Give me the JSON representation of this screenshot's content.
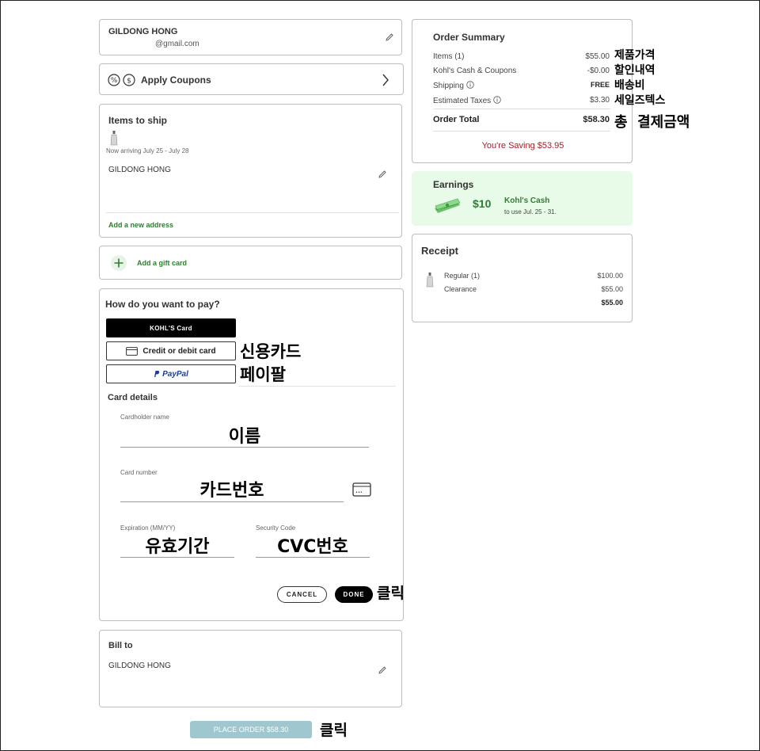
{
  "account": {
    "name": "GILDONG HONG",
    "email": "@gmail.com"
  },
  "coupons": {
    "label": "Apply Coupons"
  },
  "items_to_ship": {
    "title": "Items to ship",
    "arrival": "Now arriving July 25 - July 28",
    "address_name": "GILDONG HONG",
    "add_address": "Add a new address"
  },
  "gift_card": {
    "label": "Add a gift card"
  },
  "payment": {
    "title": "How do you want to pay?",
    "kohls_card": "KOHL'S Card",
    "credit_debit": "Credit or debit card",
    "paypal": "PayPal",
    "card_details_title": "Card details",
    "cardholder_label": "Cardholder name",
    "cardholder_value": "이름",
    "card_number_label": "Card number",
    "card_number_value": "카드번호",
    "expiration_label": "Expiration (MM/YY)",
    "expiration_value": "유효기간",
    "security_label": "Security Code",
    "security_value": "CVC번호",
    "cancel_label": "CANCEL",
    "done_label": "DONE"
  },
  "bill_to": {
    "title": "Bill to",
    "name": "GILDONG HONG"
  },
  "place_order": {
    "label": "PLACE ORDER $58.30"
  },
  "order_summary": {
    "title": "Order Summary",
    "rows": [
      {
        "label": "Items (1)",
        "value": "$55.00"
      },
      {
        "label": "Kohl's Cash & Coupons",
        "value": "-$0.00"
      },
      {
        "label": "Shipping",
        "value": "FREE"
      },
      {
        "label": "Estimated Taxes",
        "value": "$3.30"
      }
    ],
    "total_label": "Order Total",
    "total_value": "$58.30",
    "saving": "You're Saving $53.95"
  },
  "earnings": {
    "title": "Earnings",
    "amount": "$10",
    "cash_label": "Kohl's Cash",
    "cash_note": "to use Jul. 25 - 31."
  },
  "receipt": {
    "title": "Receipt",
    "regular_label": "Regular (1)",
    "regular_value": "$100.00",
    "clearance_label": "Clearance",
    "clearance_value": "$55.00",
    "total_value": "$55.00"
  },
  "annotations": {
    "product_price": "제품가격",
    "discount": "할인내역",
    "shipping": "배송비",
    "sales_tax": "세일즈텍스",
    "total": "총  결제금액",
    "credit_card": "신용카드",
    "paypal": "페이팔",
    "click_done": "클릭",
    "click_place": "클릭"
  },
  "colors": {
    "accent_green": "#2e7d32",
    "saving_red": "#a3222b",
    "earnings_bg": "#e8fbe8",
    "place_order_bg": "#9fc7d0"
  }
}
